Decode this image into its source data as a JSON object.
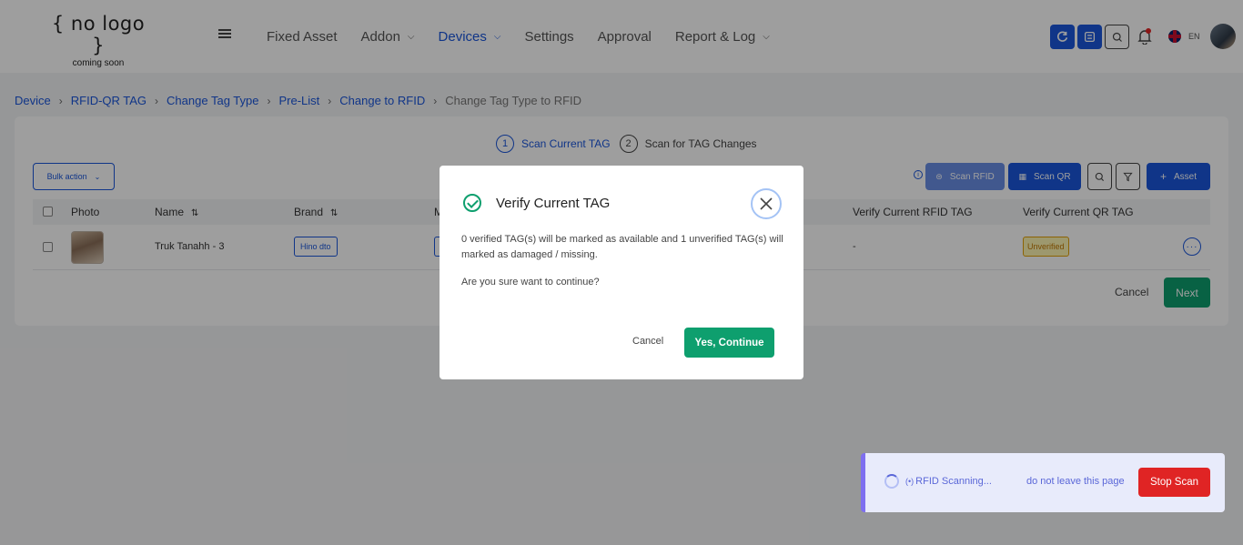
{
  "header": {
    "logo_main": "{ no logo }",
    "logo_sub": "coming soon",
    "nav": [
      {
        "label": "Fixed Asset",
        "dropdown": false,
        "active": false
      },
      {
        "label": "Addon",
        "dropdown": true,
        "active": false
      },
      {
        "label": "Devices",
        "dropdown": true,
        "active": true
      },
      {
        "label": "Settings",
        "dropdown": false,
        "active": false
      },
      {
        "label": "Approval",
        "dropdown": false,
        "active": false
      },
      {
        "label": "Report & Log",
        "dropdown": true,
        "active": false
      }
    ],
    "language": "EN",
    "icons": [
      "refresh-icon",
      "list-icon",
      "search-icon",
      "bell-icon",
      "uk-flag-icon",
      "avatar"
    ]
  },
  "breadcrumb": [
    "Device",
    "RFID-QR TAG",
    "Change Tag Type",
    "Pre-List",
    "Change to RFID",
    "Change Tag Type to RFID"
  ],
  "stepper": [
    {
      "number": "1",
      "label": "Scan Current TAG",
      "active": true
    },
    {
      "number": "2",
      "label": "Scan for TAG Changes",
      "active": false
    }
  ],
  "toolbar": {
    "bulk_action": "Bulk action",
    "scan_rfid": "Scan RFID",
    "scan_qr": "Scan QR",
    "add_asset": "Asset"
  },
  "table": {
    "columns": [
      "Photo",
      "Name",
      "Brand",
      "M",
      "Verify Current RFID TAG",
      "Verify Current QR TAG"
    ],
    "rows": [
      {
        "name": "Truk Tanahh - 3",
        "brand": "Hino dto",
        "rfid_status": "-",
        "qr_status": "Unverified"
      }
    ]
  },
  "footer": {
    "cancel": "Cancel",
    "next": "Next"
  },
  "modal": {
    "title": "Verify Current TAG",
    "message": "0 verified TAG(s) will be marked as available and 1 unverified TAG(s) will marked as damaged / missing.",
    "question": "Are you sure want to continue?",
    "cancel": "Cancel",
    "confirm": "Yes, Continue"
  },
  "scan_toast": {
    "status": "RFID Scanning...",
    "warning": "do not leave this page",
    "stop": "Stop Scan"
  },
  "colors": {
    "primary": "#1a56db",
    "success": "#0e9f6e",
    "danger": "#e02424",
    "warning": "#e3a008"
  }
}
